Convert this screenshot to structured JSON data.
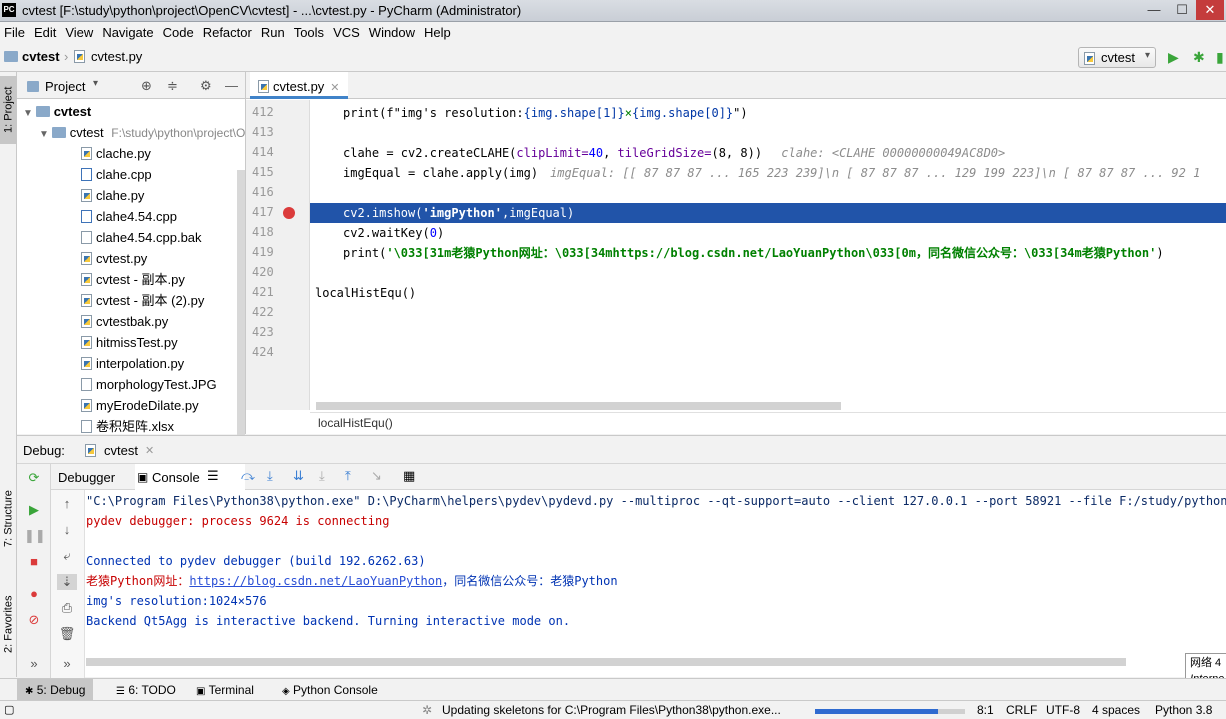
{
  "window": {
    "title": "cvtest [F:\\study\\python\\project\\OpenCV\\cvtest] - ...\\cvtest.py - PyCharm (Administrator)",
    "app_icon": "PC",
    "min": "—",
    "max": "☐",
    "close": "✕"
  },
  "menu": [
    "File",
    "Edit",
    "View",
    "Navigate",
    "Code",
    "Refactor",
    "Run",
    "Tools",
    "VCS",
    "Window",
    "Help"
  ],
  "nav": {
    "project": "cvtest",
    "file": "cvtest.py",
    "run_config": "cvtest"
  },
  "left_stripe": {
    "project_tab": "1: Project",
    "structure_tab": "7: Structure",
    "favorites_tab": "2: Favorites"
  },
  "project_panel": {
    "title": "Project",
    "root": "cvtest",
    "folder": "cvtest",
    "folder_path": "F:\\study\\python\\project\\OpenCV\\cvtest",
    "files": [
      {
        "name": "clache.py",
        "type": "py"
      },
      {
        "name": "clahe.cpp",
        "type": "cpp"
      },
      {
        "name": "clahe.py",
        "type": "py"
      },
      {
        "name": "clahe4.54.cpp",
        "type": "cpp"
      },
      {
        "name": "clahe4.54.cpp.bak",
        "type": "file"
      },
      {
        "name": "cvtest.py",
        "type": "py"
      },
      {
        "name": "cvtest - 副本.py",
        "type": "py"
      },
      {
        "name": "cvtest - 副本 (2).py",
        "type": "py"
      },
      {
        "name": "cvtestbak.py",
        "type": "py"
      },
      {
        "name": "hitmissTest.py",
        "type": "py"
      },
      {
        "name": "interpolation.py",
        "type": "py"
      },
      {
        "name": "morphologyTest.JPG",
        "type": "img"
      },
      {
        "name": "myErodeDilate.py",
        "type": "py"
      },
      {
        "name": "卷积矩阵.xlsx",
        "type": "file"
      }
    ]
  },
  "editor": {
    "tab": "cvtest.py",
    "line_numbers": [
      "412",
      "413",
      "414",
      "415",
      "416",
      "417",
      "418",
      "419",
      "420",
      "421",
      "422",
      "423",
      "424"
    ],
    "lines": {
      "l412a": "print(f\"img's resolution:",
      "l412b": "{img.shape[1]}",
      "l412c": "×",
      "l412d": "{img.shape[0]}",
      "l412e": "\")",
      "l414a": "clahe = cv2.createCLAHE(",
      "l414b": "clipLimit=",
      "l414c": "40",
      "l414d": ", ",
      "l414e": "tileGridSize=",
      "l414f": "(8, 8))",
      "l414hint": "clahe: <CLAHE 00000000049AC8D0>",
      "l415a": "imgEqual = clahe.apply(img)",
      "l415hint": "imgEqual: [[ 87  87  87 ... 165 223 239]\\n [ 87  87  87 ... 129 199 223]\\n [ 87  87  87 ...  92 1",
      "l417a": "cv2.imshow(",
      "l417b": "'imgPython'",
      "l417c": ",imgEqual)",
      "l418a": "cv2.waitKey(",
      "l418b": "0",
      "l418c": ")",
      "l419a": "print(",
      "l419b": "'\\033[31m老猿Python网址：\\033[34mhttps://blog.csdn.net/LaoYuanPython\\033[0m，同名微信公众号：\\033[34m老猿Python'",
      "l419c": ")",
      "l421a": "localHistEqu()"
    },
    "breadcrumb": "localHistEqu()"
  },
  "debug": {
    "label": "Debug:",
    "config": "cvtest",
    "tab_debugger": "Debugger",
    "tab_console": "Console",
    "console": {
      "l1": "\"C:\\Program Files\\Python38\\python.exe\" D:\\PyCharm\\helpers\\pydev\\pydevd.py --multiproc --qt-support=auto --client 127.0.0.1 --port 58921 --file F:/study/python/proj",
      "l2": "pydev debugger: process 9624 is connecting",
      "l3": "Connected to pydev debugger (build 192.6262.63)",
      "l4a": "老猿Python网址：",
      "l4b": "https://blog.csdn.net/LaoYuanPython",
      "l4c": "，同名微信公众号：老猿Python",
      "l5": "img's resolution:1024×576",
      "l6": "Backend Qt5Agg is interactive backend. Turning interactive mode on."
    }
  },
  "bottom_tabs": [
    "5: Debug",
    "6: TODO",
    "Terminal",
    "Python Console"
  ],
  "status": {
    "message": "Updating skeletons for C:\\Program Files\\Python38\\python.exe...",
    "progress": 0.82,
    "position": "8:1",
    "line_sep": "CRLF",
    "encoding": "UTF-8",
    "indent": "4 spaces",
    "interpreter": "Python 3.8"
  },
  "tooltip": {
    "l1": "网络 4",
    "l2": "Interne"
  },
  "colors": {
    "selection": "#2154a9",
    "breakpoint": "#db3b3b",
    "accent": "#4083c9"
  }
}
